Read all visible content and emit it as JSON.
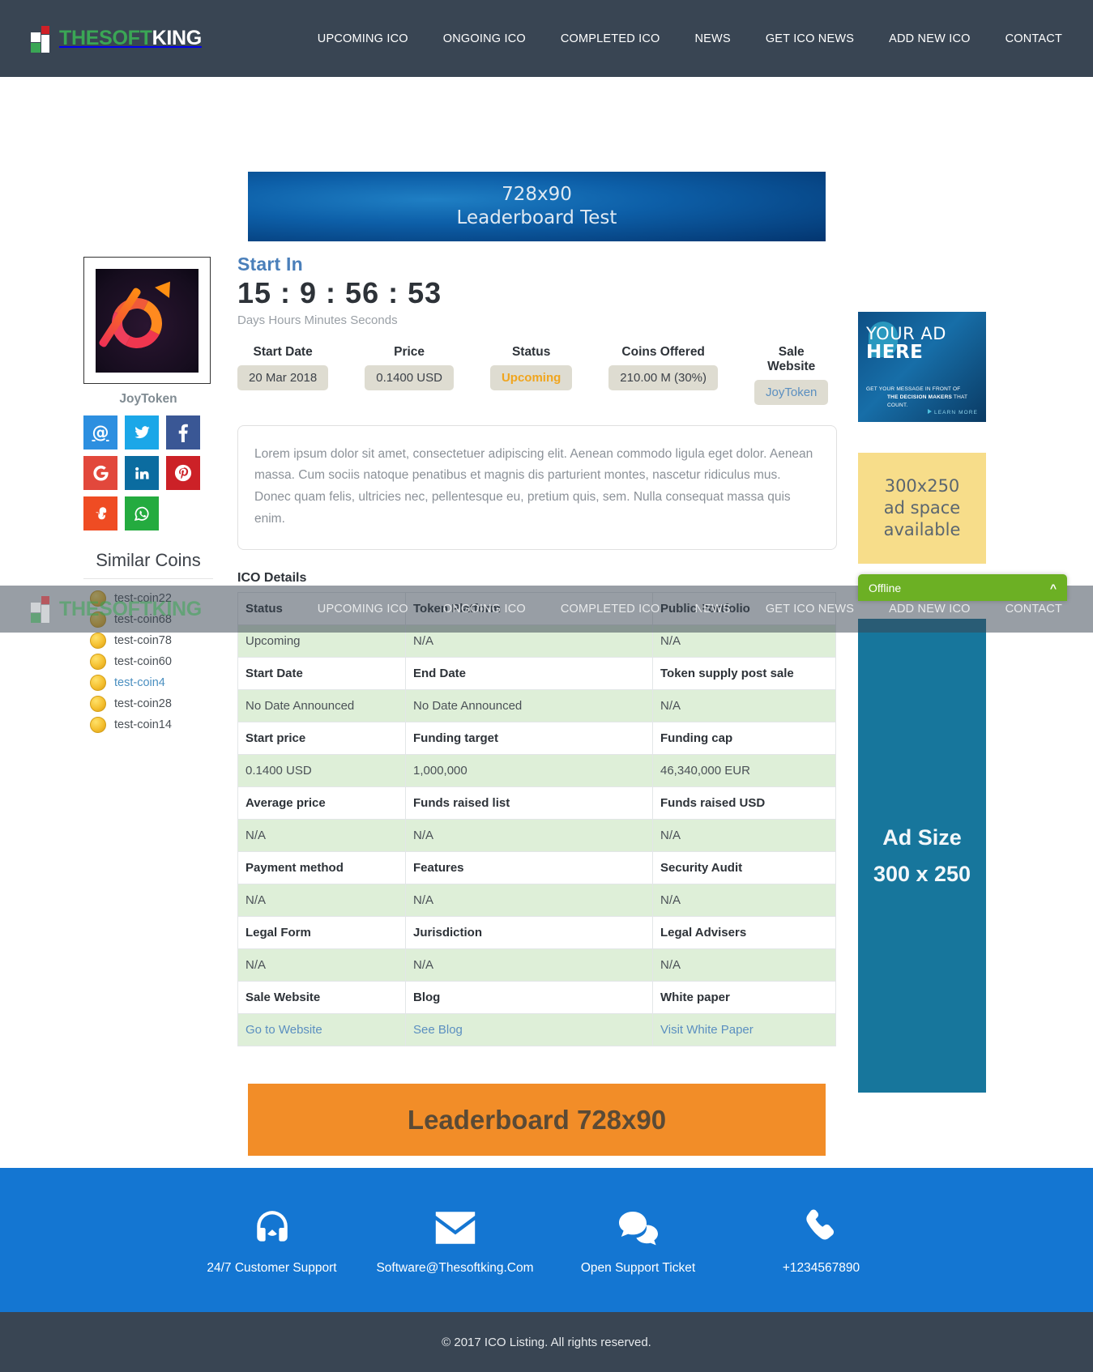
{
  "brand": {
    "name_green_1": "THESOFT",
    "name_white": "KING",
    "logo_icon": "squares-logo-icon"
  },
  "nav": {
    "items": [
      {
        "label": "UPCOMING ICO"
      },
      {
        "label": "ONGOING ICO"
      },
      {
        "label": "COMPLETED ICO"
      },
      {
        "label": "NEWS"
      },
      {
        "label": "GET ICO NEWS"
      },
      {
        "label": "ADD NEW ICO"
      },
      {
        "label": "CONTACT"
      }
    ]
  },
  "ads": {
    "leaderboard_top_line1": "728x90",
    "leaderboard_top_line2": "Leaderboard Test",
    "leaderboard_bottom": "Leaderboard 728x90",
    "your_ad_line1": "YOUR AD",
    "your_ad_line2": "HERE",
    "your_ad_sub1": "GET YOUR MESSAGE IN FRONT OF",
    "your_ad_sub2_a": "THE DECISION MAKERS",
    "your_ad_sub2_b": " THAT COUNT.",
    "your_ad_cta": "LEARN MORE",
    "yellow_line1": "300x250",
    "yellow_line2": "ad space",
    "yellow_line3": "available",
    "teal_line1": "Ad Size",
    "teal_line2": "300 x 250"
  },
  "coin": {
    "name": "JoyToken",
    "image_alt": "joytoken-logo"
  },
  "social": [
    {
      "name": "email",
      "icon": "email-icon",
      "color": "#2d8fe0"
    },
    {
      "name": "twitter",
      "icon": "twitter-icon",
      "color": "#1ba7e8"
    },
    {
      "name": "facebook",
      "icon": "facebook-icon",
      "color": "#3a5795"
    },
    {
      "name": "google",
      "icon": "google-plus-icon",
      "color": "#e2483c"
    },
    {
      "name": "linkedin",
      "icon": "linkedin-icon",
      "color": "#0b6ca0"
    },
    {
      "name": "pinterest",
      "icon": "pinterest-icon",
      "color": "#cc2127"
    },
    {
      "name": "stumbleupon",
      "icon": "stumbleupon-icon",
      "color": "#ef4c23"
    },
    {
      "name": "whatsapp",
      "icon": "whatsapp-icon",
      "color": "#24ab3f"
    }
  ],
  "similar": {
    "title": "Similar Coins",
    "items": [
      {
        "label": "test-coin22",
        "highlighted": false
      },
      {
        "label": "test-coin68",
        "highlighted": false
      },
      {
        "label": "test-coin78",
        "highlighted": false
      },
      {
        "label": "test-coin60",
        "highlighted": false
      },
      {
        "label": "test-coin4",
        "highlighted": true
      },
      {
        "label": "test-coin28",
        "highlighted": false
      },
      {
        "label": "test-coin14",
        "highlighted": false
      }
    ]
  },
  "countdown": {
    "heading": "Start In",
    "value": "15 : 9 : 56 : 53",
    "units": "Days Hours Minutes Seconds"
  },
  "stats": [
    {
      "label": "Start Date",
      "value": "20 Mar 2018",
      "style": "plain"
    },
    {
      "label": "Price",
      "value": "0.1400 USD",
      "style": "plain"
    },
    {
      "label": "Status",
      "value": "Upcoming",
      "style": "upcoming"
    },
    {
      "label": "Coins Offered",
      "value": "210.00 M (30%)",
      "style": "plain"
    },
    {
      "label": "Sale Website",
      "value": "JoyToken",
      "style": "link"
    }
  ],
  "description": "Lorem ipsum dolor sit amet, consectetuer adipiscing elit. Aenean commodo ligula eget dolor. Aenean massa. Cum sociis natoque penatibus et magnis dis parturient montes, nascetur ridiculus mus. Donec quam felis, ultricies nec, pellentesque eu, pretium quis, sem. Nulla consequat massa quis enim.",
  "ico_details": {
    "section_title": "ICO Details",
    "rows": [
      {
        "type": "header",
        "cells": [
          "Status",
          "Token Platform",
          "Public Portfolio"
        ]
      },
      {
        "type": "value",
        "cells": [
          "Upcoming",
          "N/A",
          "N/A"
        ]
      },
      {
        "type": "header",
        "cells": [
          "Start Date",
          "End Date",
          "Token supply post sale"
        ]
      },
      {
        "type": "value",
        "cells": [
          "No Date Announced",
          "No Date Announced",
          "N/A"
        ]
      },
      {
        "type": "header",
        "cells": [
          "Start price",
          "Funding target",
          "Funding cap"
        ]
      },
      {
        "type": "value",
        "cells": [
          "0.1400 USD",
          "1,000,000",
          "46,340,000 EUR"
        ]
      },
      {
        "type": "header",
        "cells": [
          "Average price",
          "Funds raised list",
          "Funds raised USD"
        ]
      },
      {
        "type": "value",
        "cells": [
          "N/A",
          "N/A",
          "N/A"
        ]
      },
      {
        "type": "header",
        "cells": [
          "Payment method",
          "Features",
          "Security Audit"
        ]
      },
      {
        "type": "value",
        "cells": [
          "N/A",
          "N/A",
          "N/A"
        ]
      },
      {
        "type": "header",
        "cells": [
          "Legal Form",
          "Jurisdiction",
          "Legal Advisers"
        ]
      },
      {
        "type": "value",
        "cells": [
          "N/A",
          "N/A",
          "N/A"
        ]
      },
      {
        "type": "header",
        "cells": [
          "Sale Website",
          "Blog",
          "White paper"
        ]
      },
      {
        "type": "link",
        "cells": [
          "Go to Website",
          "See Blog",
          "Visit White Paper"
        ]
      }
    ]
  },
  "chat": {
    "status_label": "Offline",
    "chevron_icon": "chevron-up-icon"
  },
  "footer": {
    "columns": [
      {
        "icon": "headset-icon",
        "label": "24/7 Customer Support"
      },
      {
        "icon": "envelope-icon",
        "label": "Software@Thesoftking.Com"
      },
      {
        "icon": "chat-bubbles-icon",
        "label": "Open Support Ticket"
      },
      {
        "icon": "phone-icon",
        "label": "+1234567890"
      }
    ],
    "copyright": "© 2017 ICO Listing. All rights reserved."
  },
  "colors": {
    "nav_bg": "#394553",
    "accent_blue": "#1476d2",
    "green_row": "#deefd8",
    "chat_green": "#6cb024",
    "orange_ad": "#f28d28",
    "teal_ad": "#17769c"
  }
}
